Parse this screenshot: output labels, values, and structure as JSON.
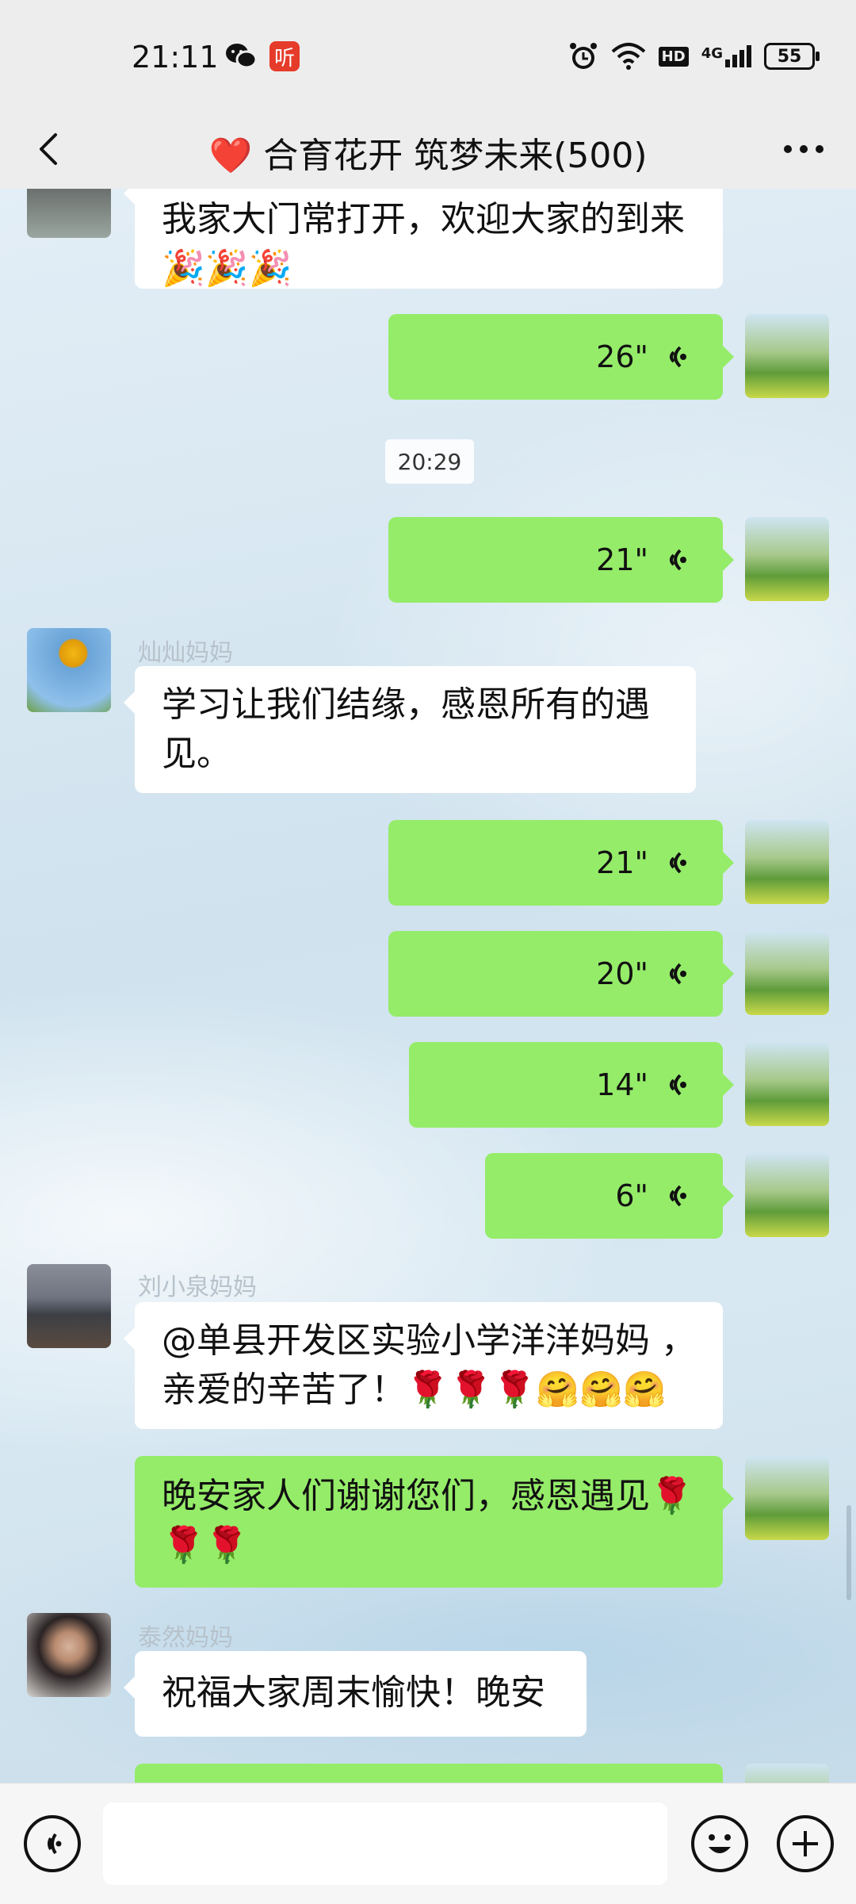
{
  "status_bar": {
    "time": "21:11",
    "app_badge": "听",
    "network": "4G",
    "hd": "HD",
    "battery": "55"
  },
  "header": {
    "title": "❤️  合育花开 筑梦未来(500)"
  },
  "timestamp": "20:29",
  "messages": [
    {
      "type": "text_in",
      "text": "我家大门常打开，欢迎大家的到来🎉🎉🎉"
    },
    {
      "type": "voice_out",
      "duration": "26\""
    },
    {
      "type": "voice_out",
      "duration": "21\""
    },
    {
      "type": "text_in",
      "sender": "灿灿妈妈",
      "text": "学习让我们结缘，感恩所有的遇见。"
    },
    {
      "type": "voice_out",
      "duration": "21\""
    },
    {
      "type": "voice_out",
      "duration": "20\""
    },
    {
      "type": "voice_out",
      "duration": "14\""
    },
    {
      "type": "voice_out",
      "duration": "6\""
    },
    {
      "type": "text_in",
      "sender": "刘小泉妈妈",
      "text": "@单县开发区实验小学洋洋妈妈 ，亲爱的辛苦了！🌹🌹🌹🤗🤗🤗"
    },
    {
      "type": "text_out",
      "text": "晚安家人们谢谢您们，感恩遇见🌹🌹🌹"
    },
    {
      "type": "text_in",
      "sender": "泰然妈妈",
      "text": "祝福大家周末愉快！晚安"
    }
  ],
  "input_bar": {
    "placeholder": "",
    "icons": [
      "voice-icon",
      "emoji-icon",
      "plus-icon"
    ]
  },
  "colors": {
    "bubble_out": "#95ec69",
    "bubble_in": "#ffffff",
    "bar_bg": "#ededed"
  }
}
